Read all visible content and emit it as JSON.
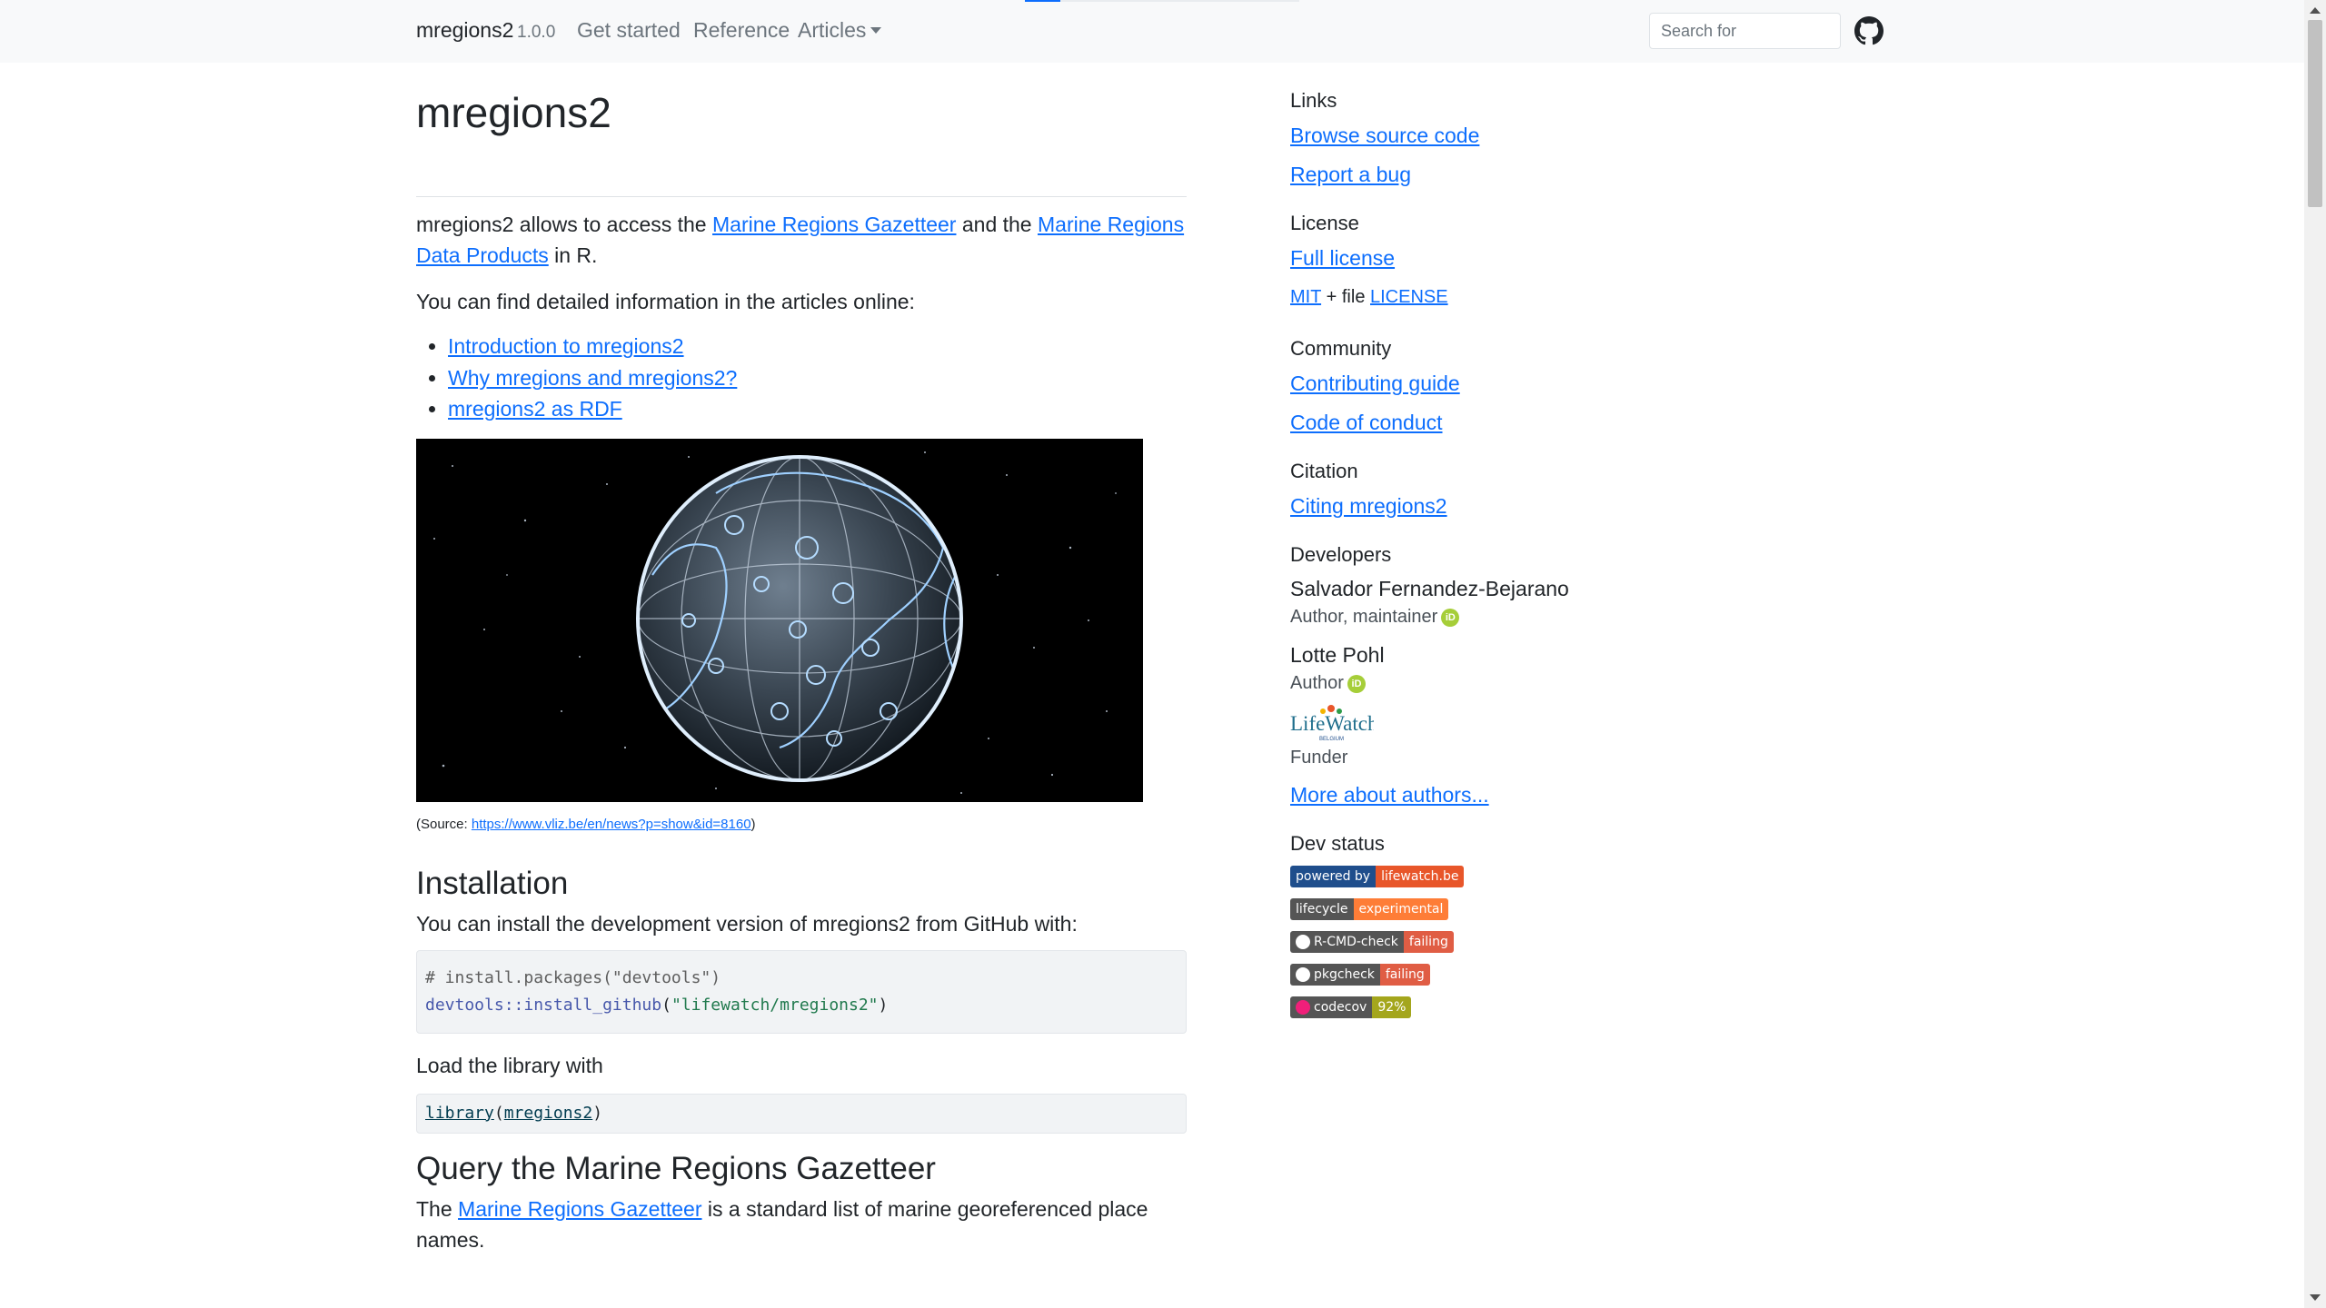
{
  "nav": {
    "brand": "mregions2",
    "version": "1.0.0",
    "links": [
      "Get started",
      "Reference",
      "Articles"
    ],
    "search_placeholder": "Search for",
    "progress_fraction": 0.13
  },
  "main": {
    "title": "mregions2",
    "intro": {
      "prefix": "mregions2 allows to access the ",
      "link1": "Marine Regions Gazetteer",
      "mid": " and the ",
      "link2a": "Marine Regions",
      "link2b": "Data Products",
      "suffix": " in R."
    },
    "articles_intro": "You can find detailed information in the articles online:",
    "articles": [
      "Introduction to mregions2",
      "Why mregions and mregions2?",
      "mregions2 as RDF"
    ],
    "source": {
      "prefix": "(Source: ",
      "url": "https://www.vliz.be/en/news?p=show&id=8160",
      "suffix": ")"
    },
    "installation": {
      "heading": "Installation",
      "text": "You can install the development version of mregions2 from GitHub with:",
      "code_comment": "# install.packages(\"devtools\")",
      "code_fn": "devtools::install_github",
      "code_open": "(",
      "code_str": "\"lifewatch/mregions2\"",
      "code_close": ")"
    },
    "load": {
      "text": "Load the library with",
      "code_fn": "library",
      "code_open": "(",
      "code_arg": "mregions2",
      "code_close": ")"
    },
    "query": {
      "heading": "Query the Marine Regions Gazetteer",
      "prefix": "The ",
      "link": "Marine Regions Gazetteer",
      "suffix_line1": " is a standard list of marine georeferenced place",
      "suffix_line2": "names."
    }
  },
  "sidebar": {
    "links_heading": "Links",
    "links": [
      "Browse source code",
      "Report a bug"
    ],
    "license_heading": "License",
    "full_license": "Full license",
    "mit": "MIT",
    "plus_file": " + file ",
    "license_file": "LICENSE",
    "community_heading": "Community",
    "community": [
      "Contributing guide",
      "Code of conduct"
    ],
    "citation_heading": "Citation",
    "citation": "Citing mregions2",
    "developers_heading": "Developers",
    "developers": [
      {
        "name": "Salvador Fernandez-Bejarano",
        "role": "Author, maintainer"
      },
      {
        "name": "Lotte Pohl",
        "role": "Author"
      }
    ],
    "funder_logo_text": "LifeWatch",
    "funder_logo_sub": "BELGIUM",
    "funder_role": "Funder",
    "more_authors": "More about authors...",
    "dev_status_heading": "Dev status",
    "badges": [
      {
        "left": "powered by",
        "right": "lifewatch.be",
        "left_color": "#1f4e8c",
        "right_color": "#e8562a"
      },
      {
        "left": "lifecycle",
        "right": "experimental",
        "left_color": "#555555",
        "right_color": "#fe7d37"
      },
      {
        "left": "R-CMD-check",
        "right": "failing",
        "left_color": "#555555",
        "right_color": "#e05d44"
      },
      {
        "left": "pkgcheck",
        "right": "failing",
        "left_color": "#555555",
        "right_color": "#e05d44"
      },
      {
        "left": "codecov",
        "right": "92%",
        "left_color": "#555555",
        "right_color": "#a4a61d"
      }
    ]
  },
  "colors": {
    "link": "#0d6efd",
    "navbar_bg": "#f8f9fa",
    "orcid": "#a6ce39"
  }
}
